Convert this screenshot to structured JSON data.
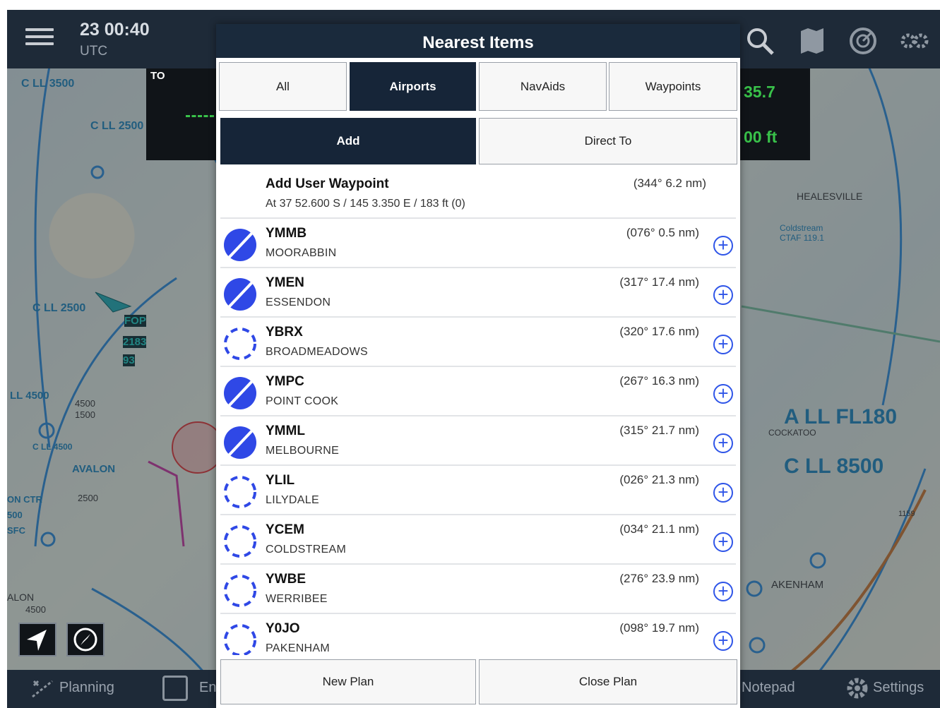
{
  "topbar": {
    "time": "23 00:40",
    "zone": "UTC"
  },
  "map": {
    "labels": [
      "C LL 3500",
      "C LL 2500",
      "C LL 2500",
      "LL 4500",
      "4500",
      "1500",
      "C LL 4500",
      "AVALON",
      "2500",
      "ON CTR",
      "500",
      "SFC",
      "ALON",
      "4500",
      "2500",
      "1159",
      "HEALESVILLE",
      "Coldstream",
      "CTAF 119.1",
      "A LL FL180",
      "C LL 8500",
      "COCKATOO",
      "AKENHAM",
      "FOP",
      "2183",
      "93",
      "TO"
    ],
    "instrument_values": [
      "35.7",
      "00 ft"
    ]
  },
  "bottombar": {
    "planning": "Planning",
    "en": "En",
    "notepad": "Notepad",
    "settings": "Settings"
  },
  "modal": {
    "title": "Nearest Items",
    "tabs": [
      "All",
      "Airports",
      "NavAids",
      "Waypoints"
    ],
    "active_tab": "Airports",
    "actions": {
      "add": "Add",
      "direct_to": "Direct To",
      "active": "Add"
    },
    "user_waypoint": {
      "title": "Add User Waypoint",
      "coords": "At 37 52.600 S / 145 3.350 E / 183 ft (0)",
      "bearing": "(344° 6.2 nm)"
    },
    "items": [
      {
        "ident": "YMMB",
        "name": "MOORABBIN",
        "bearing": "(076° 0.5 nm)",
        "type": "towered"
      },
      {
        "ident": "YMEN",
        "name": "ESSENDON",
        "bearing": "(317° 17.4 nm)",
        "type": "towered"
      },
      {
        "ident": "YBRX",
        "name": "BROADMEADOWS",
        "bearing": "(320° 17.6 nm)",
        "type": "non-towered"
      },
      {
        "ident": "YMPC",
        "name": "POINT COOK",
        "bearing": "(267° 16.3 nm)",
        "type": "towered"
      },
      {
        "ident": "YMML",
        "name": "MELBOURNE",
        "bearing": "(315° 21.7 nm)",
        "type": "towered"
      },
      {
        "ident": "YLIL",
        "name": "LILYDALE",
        "bearing": "(026° 21.3 nm)",
        "type": "non-towered"
      },
      {
        "ident": "YCEM",
        "name": "COLDSTREAM",
        "bearing": "(034° 21.1 nm)",
        "type": "non-towered"
      },
      {
        "ident": "YWBE",
        "name": "WERRIBEE",
        "bearing": "(276° 23.9 nm)",
        "type": "non-towered"
      },
      {
        "ident": "Y0JO",
        "name": "PAKENHAM",
        "bearing": "(098° 19.7 nm)",
        "type": "non-towered"
      }
    ],
    "footer": {
      "new_plan": "New Plan",
      "close_plan": "Close Plan"
    }
  },
  "colors": {
    "header": "#1a2a3c",
    "active": "#162538",
    "airport_blue": "#2f48e6"
  }
}
